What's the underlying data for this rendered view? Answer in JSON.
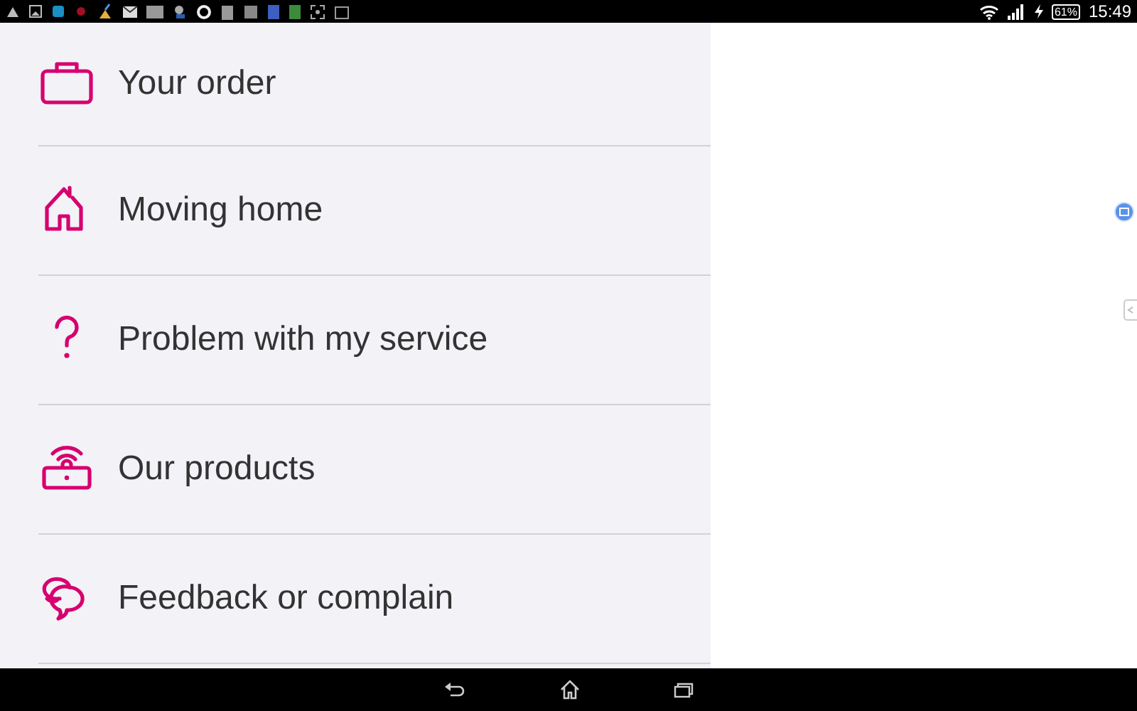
{
  "status_bar": {
    "battery": "61%",
    "time": "15:49"
  },
  "menu": {
    "items": [
      {
        "label": "Your order",
        "kind": "briefcase"
      },
      {
        "label": "Moving home",
        "kind": "house"
      },
      {
        "label": "Problem with my service",
        "kind": "question"
      },
      {
        "label": "Our products",
        "kind": "router"
      },
      {
        "label": "Feedback or complain",
        "kind": "chat"
      }
    ]
  }
}
